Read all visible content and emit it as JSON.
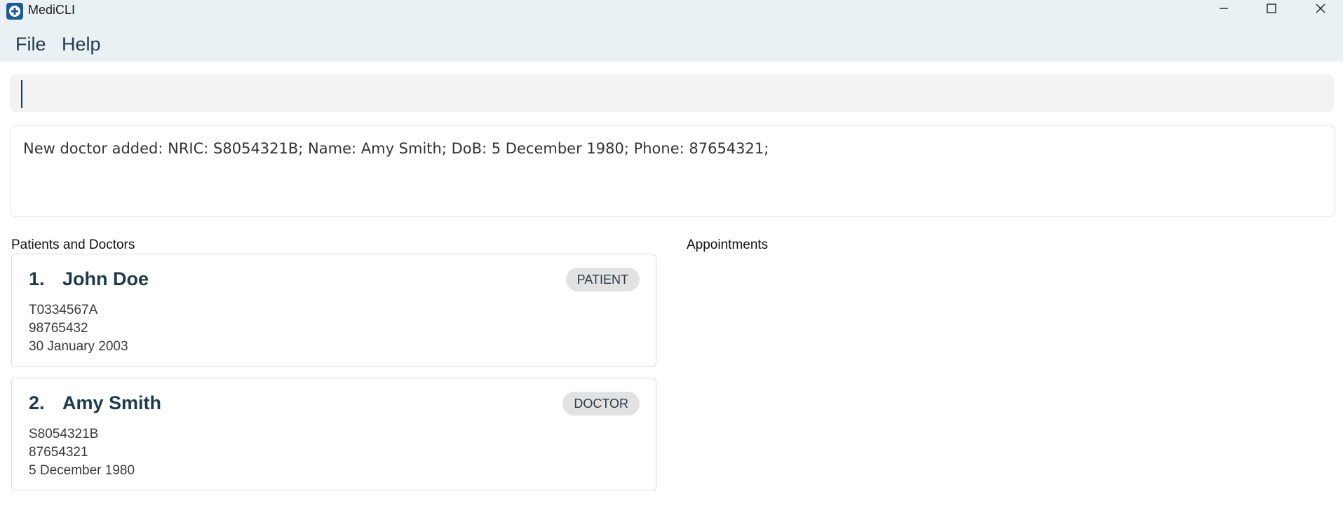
{
  "window": {
    "title": "MediCLI",
    "minimize_icon": "minimize-icon",
    "maximize_icon": "maximize-icon",
    "close_icon": "close-icon"
  },
  "menu": {
    "items": [
      {
        "label": "File"
      },
      {
        "label": "Help"
      }
    ]
  },
  "command": {
    "value": ""
  },
  "result": {
    "message": "New doctor added: NRIC: S8054321B; Name: Amy Smith; DoB: 5 December 1980; Phone: 87654321;"
  },
  "people_panel": {
    "label": "Patients and Doctors",
    "cards": [
      {
        "index": "1.",
        "name": "John Doe",
        "tag": "PATIENT",
        "nric": "T0334567A",
        "phone": "98765432",
        "dob": "30 January 2003"
      },
      {
        "index": "2.",
        "name": "Amy Smith",
        "tag": "DOCTOR",
        "nric": "S8054321B",
        "phone": "87654321",
        "dob": "5 December 1980"
      }
    ]
  },
  "appointments_panel": {
    "label": "Appointments"
  },
  "colors": {
    "chrome": "#eaf1f5",
    "accent": "#1c5b99",
    "tag_bg": "#e2e2e2"
  }
}
